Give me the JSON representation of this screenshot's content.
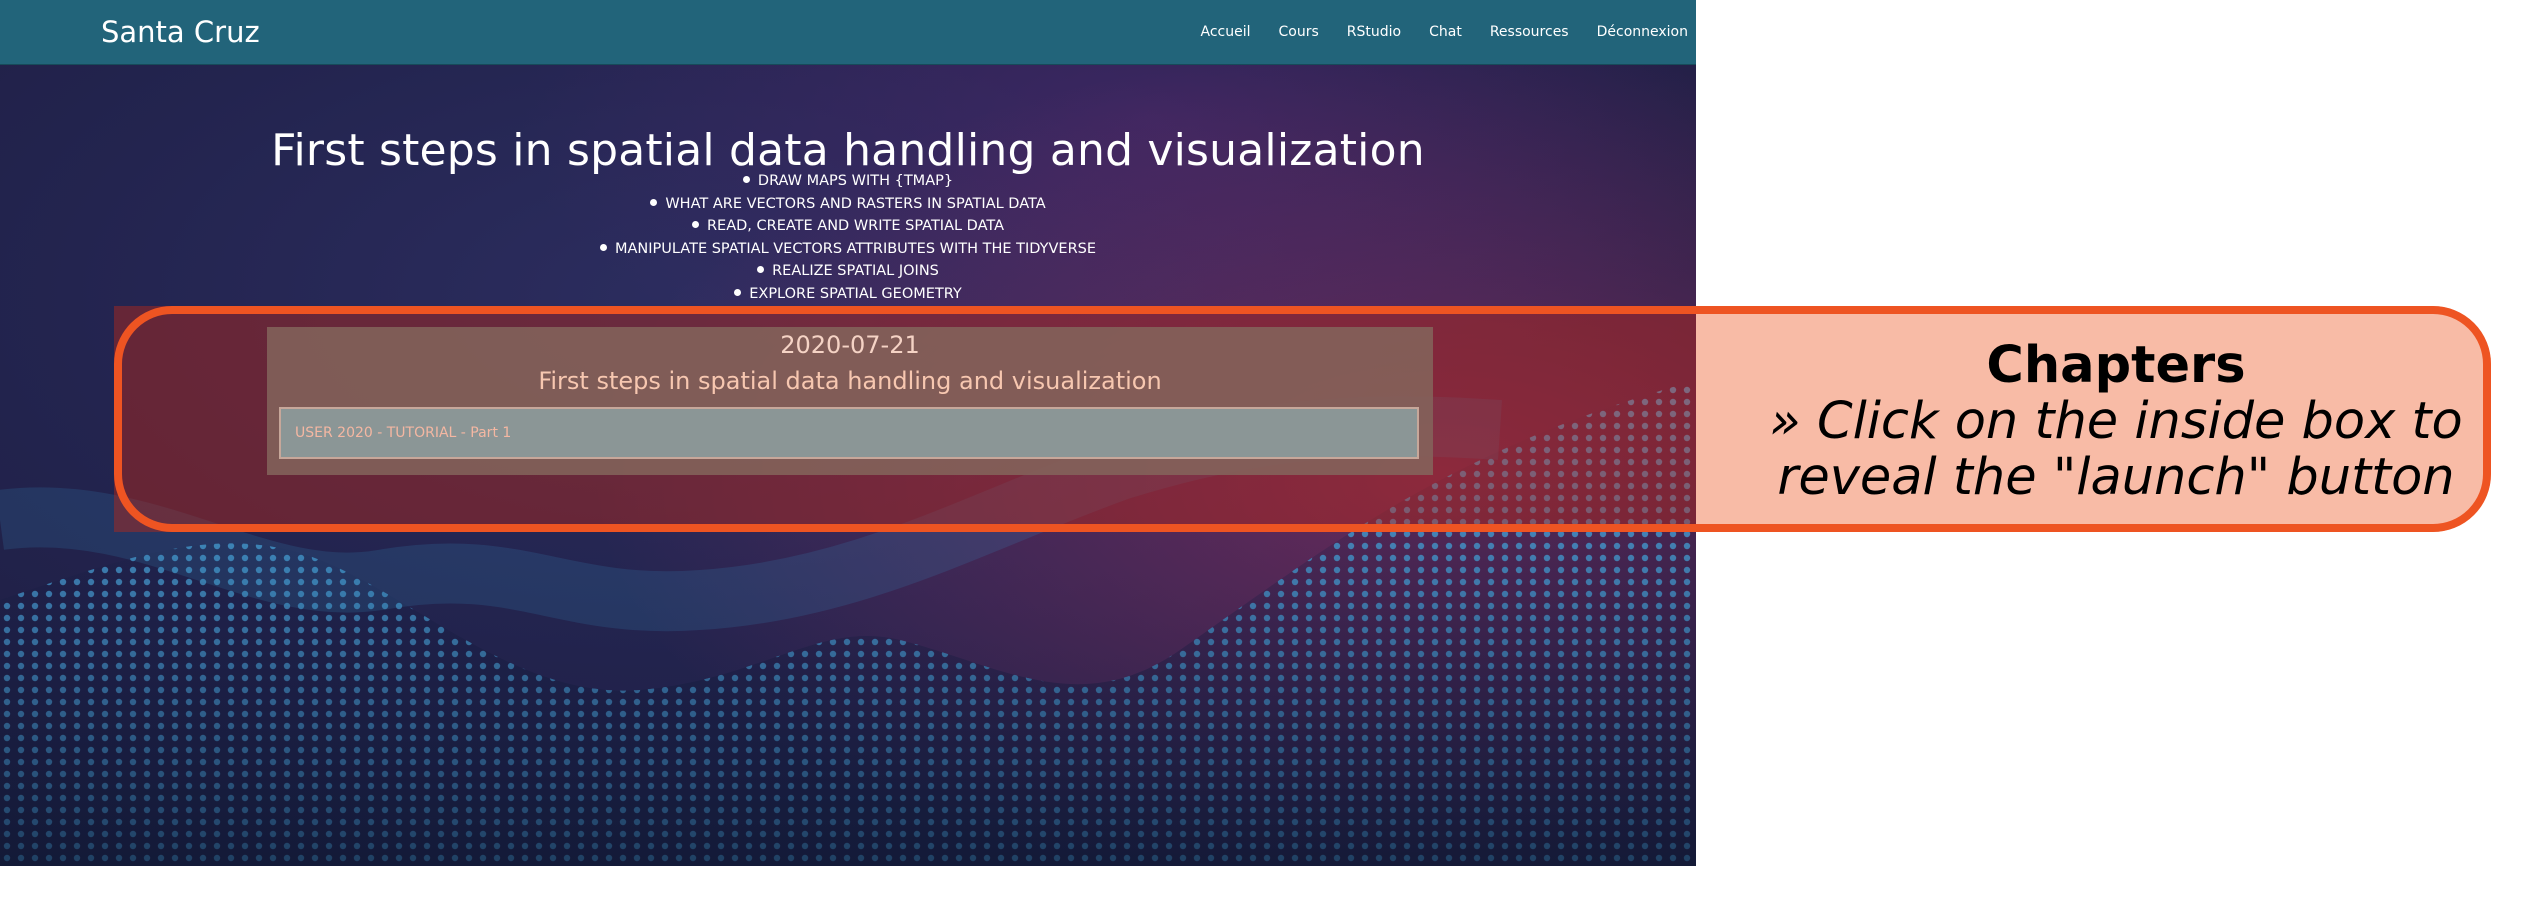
{
  "navbar": {
    "brand": "Santa Cruz",
    "links": [
      "Accueil",
      "Cours",
      "RStudio",
      "Chat",
      "Ressources",
      "Déconnexion"
    ],
    "color": "#22647a"
  },
  "hero": {
    "title": "First steps in spatial data handling and visualization",
    "topics": [
      "DRAW MAPS WITH {TMAP}",
      "WHAT ARE VECTORS AND RASTERS IN SPATIAL DATA",
      "READ, CREATE AND WRITE SPATIAL DATA",
      "MANIPULATE SPATIAL VECTORS ATTRIBUTES WITH THE TIDYVERSE",
      "REALIZE SPATIAL JOINS",
      "EXPLORE SPATIAL GEOMETRY"
    ]
  },
  "card": {
    "date": "2020-07-21",
    "title": "First steps in spatial data handling and visualization",
    "chapter_label": "USER 2020 - TUTORIAL - Part 1"
  },
  "callout": {
    "heading": "Chapters",
    "body_line1": "» Click on the inside box to",
    "body_line2": "reveal the \"launch\" button",
    "accent_color": "#ee5422",
    "fill_color": "#f8bba6"
  }
}
